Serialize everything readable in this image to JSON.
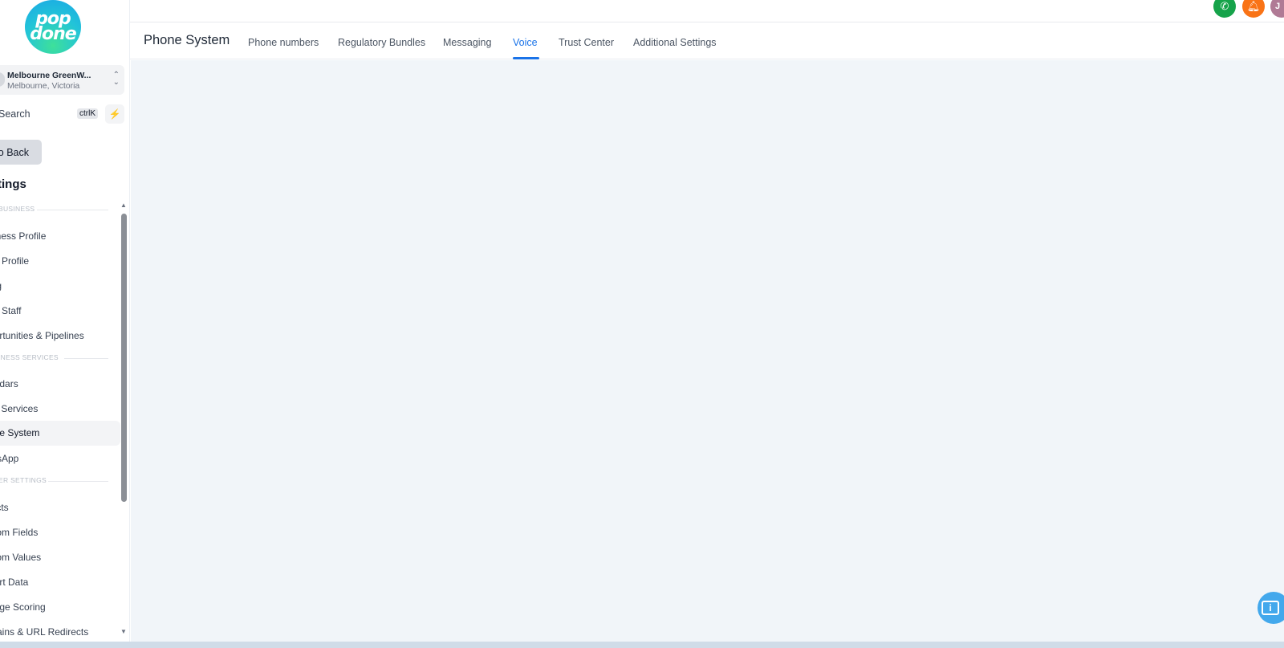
{
  "brand": {
    "logo_line1": "pop",
    "logo_line2": "done"
  },
  "location": {
    "name": "Melbourne GreenW...",
    "sub": "Melbourne, Victoria"
  },
  "search": {
    "label": "Search",
    "shortcut": "ctrlK"
  },
  "go_back": "o Back",
  "settings_title": "tings",
  "sidebar": {
    "sections": [
      {
        "label": "BUSINESS"
      },
      {
        "label": "INESS SERVICES"
      },
      {
        "label": "ER SETTINGS"
      }
    ],
    "items": [
      {
        "label": "siness Profile"
      },
      {
        "label": "Profile"
      },
      {
        "label": "ing"
      },
      {
        "label": "Staff"
      },
      {
        "label": "portunities & Pipelines"
      },
      {
        "label": "endars"
      },
      {
        "label": "ail Services"
      },
      {
        "label": "one System"
      },
      {
        "label": "atsApp"
      },
      {
        "label": "jects"
      },
      {
        "label": "stom Fields"
      },
      {
        "label": "stom Values"
      },
      {
        "label": "port Data"
      },
      {
        "label": "nage Scoring"
      },
      {
        "label": "mains & URL Redirects"
      }
    ]
  },
  "header": {
    "page_title": "Phone System",
    "tabs": [
      {
        "label": "Phone numbers"
      },
      {
        "label": "Regulatory Bundles"
      },
      {
        "label": "Messaging"
      },
      {
        "label": "Voice",
        "active": true
      },
      {
        "label": "Trust Center"
      },
      {
        "label": "Additional Settings"
      }
    ],
    "user_initial": "J"
  },
  "colors": {
    "accent": "#1a73e8",
    "phone_icon": "#16a34a",
    "bell_icon": "#f97316",
    "avatar": "#b07a95",
    "help_fab": "#43a8ec",
    "content_bg": "#f1f5f9"
  },
  "icons": [
    "phone-icon",
    "bell-icon",
    "bolt-icon",
    "chevron-up-down-icon",
    "help-icon"
  ]
}
